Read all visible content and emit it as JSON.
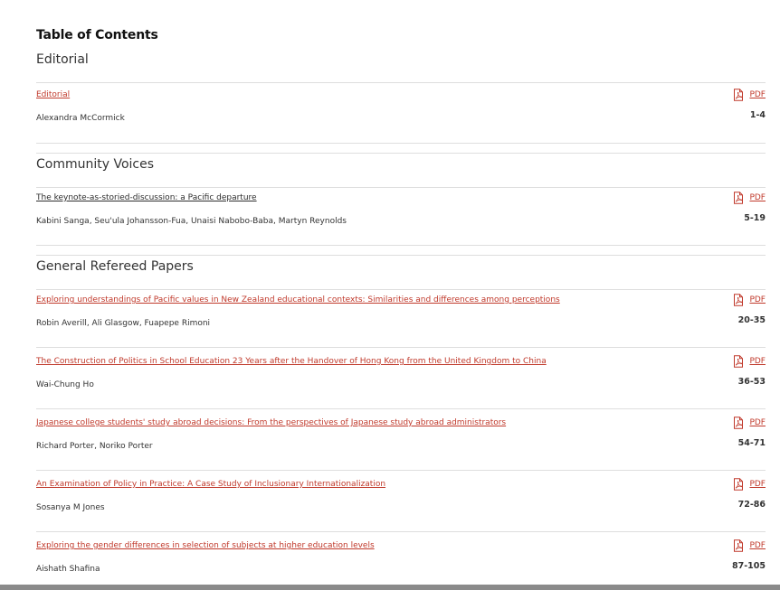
{
  "toc_title": "Table of Contents",
  "colors": {
    "link": "#c0392b",
    "divider": "#dedede"
  },
  "pdf_label": "PDF",
  "sections": [
    {
      "heading": "Editorial",
      "articles": [
        {
          "title": "Editorial",
          "authors": "Alexandra McCormick",
          "pages": "1-4"
        }
      ]
    },
    {
      "heading": "Community Voices",
      "articles": [
        {
          "title": "The keynote-as-storied-discussion: a Pacific departure",
          "authors": "Kabini Sanga, Seu'ula Johansson-Fua, Unaisi Nabobo-Baba, Martyn Reynolds",
          "pages": "5-19"
        }
      ]
    },
    {
      "heading": "General Refereed Papers",
      "articles": [
        {
          "title": "Exploring understandings of Pacific values in New Zealand educational contexts: Similarities and differences among perceptions",
          "authors": "Robin Averill, Ali Glasgow, Fuapepe Rimoni",
          "pages": "20-35"
        },
        {
          "title": "The Construction of Politics in School Education 23 Years after the Handover of Hong Kong from the United Kingdom to China",
          "authors": "Wai-Chung Ho",
          "pages": "36-53"
        },
        {
          "title": "Japanese college students' study abroad decisions: From the perspectives of Japanese study abroad administrators",
          "authors": "Richard Porter, Noriko Porter",
          "pages": "54-71"
        },
        {
          "title": "An Examination of Policy in Practice: A Case Study of Inclusionary Internationalization",
          "authors": "Sosanya M Jones",
          "pages": "72-86"
        },
        {
          "title": "Exploring the gender differences in selection of subjects at higher education levels",
          "authors": "Aishath Shafina",
          "pages": "87-105"
        }
      ]
    }
  ]
}
